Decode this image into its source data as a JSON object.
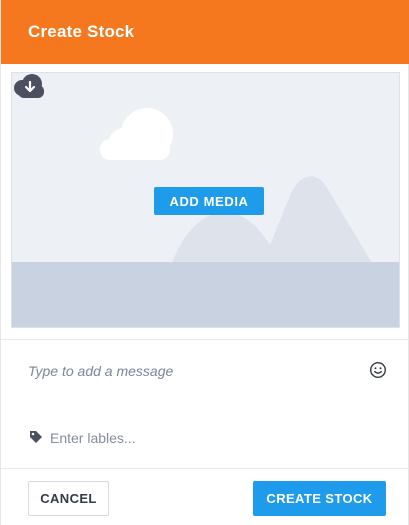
{
  "dialog": {
    "title": "Create Stock"
  },
  "media": {
    "add_label": "ADD MEDIA",
    "placeholder_icon": "image-placeholder-icon",
    "download_icon": "cloud-download-icon"
  },
  "message": {
    "placeholder": "Type to add a message",
    "emoji_icon": "smiley-icon"
  },
  "labels": {
    "placeholder": "Enter lables...",
    "icon": "tag-icon"
  },
  "footer": {
    "cancel_label": "CANCEL",
    "create_label": "CREATE STOCK"
  },
  "colors": {
    "header": "#f5781e",
    "primary": "#1e9bea",
    "media_bg": "#edf0f5",
    "ground": "#c9d2e0"
  }
}
